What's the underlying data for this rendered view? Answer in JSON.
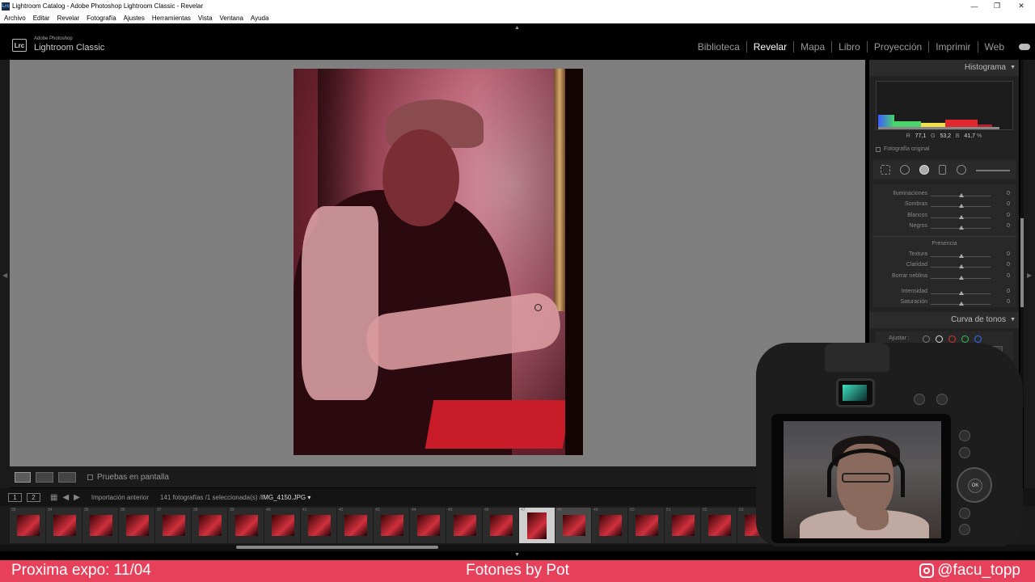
{
  "window": {
    "title": "Lightroom Catalog - Adobe Photoshop Lightroom Classic - Revelar",
    "app_icon": "Lrc",
    "controls": [
      "—",
      "❐",
      "✕"
    ]
  },
  "menu": [
    "Archivo",
    "Editar",
    "Revelar",
    "Fotografía",
    "Ajustes",
    "Herramientas",
    "Vista",
    "Ventana",
    "Ayuda"
  ],
  "brand": {
    "logo": "Lrc",
    "small": "Adobe Photoshop",
    "big": "Lightroom Classic"
  },
  "modules": [
    {
      "label": "Biblioteca",
      "active": false
    },
    {
      "label": "Revelar",
      "active": true
    },
    {
      "label": "Mapa",
      "active": false
    },
    {
      "label": "Libro",
      "active": false
    },
    {
      "label": "Proyección",
      "active": false
    },
    {
      "label": "Imprimir",
      "active": false
    },
    {
      "label": "Web",
      "active": false
    }
  ],
  "toolbar": {
    "proof_label": "Pruebas en pantalla"
  },
  "filmstrip_header": {
    "monitor1": "1",
    "monitor2": "2",
    "source": "Importación anterior",
    "count": "141 fotografías /1 seleccionada(s) /",
    "filename": "IMG_4150.JPG ▾"
  },
  "filmstrip": {
    "indexes": [
      "33",
      "34",
      "35",
      "36",
      "37",
      "38",
      "39",
      "40",
      "41",
      "42",
      "43",
      "44",
      "45",
      "46",
      "47",
      "48",
      "49",
      "50",
      "51",
      "52",
      "53"
    ],
    "selected_index": 14,
    "active_index": 15
  },
  "histogram": {
    "title": "Histograma",
    "r_label": "R",
    "r_value": "77,1",
    "g_label": "G",
    "g_value": "53,2",
    "b_label": "B",
    "b_value": "41,7",
    "unit": "%",
    "original_label": "Fotografía original"
  },
  "basic": {
    "rows": [
      {
        "label": "Iluminaciones",
        "value": "0"
      },
      {
        "label": "Sombras",
        "value": "0"
      },
      {
        "label": "Blancos",
        "value": "0"
      },
      {
        "label": "Negros",
        "value": "0"
      }
    ],
    "presence_title": "Presencia",
    "presence_rows": [
      {
        "label": "Textura",
        "value": "0"
      },
      {
        "label": "Claridad",
        "value": "0"
      },
      {
        "label": "Borrar neblina",
        "value": "0"
      },
      {
        "label": "Intensidad",
        "value": "0"
      },
      {
        "label": "Saturación",
        "value": "0"
      }
    ]
  },
  "tone_curve": {
    "title": "Curva de tonos",
    "adjust_label": "Ajustar :"
  },
  "camera": {
    "ok_label": "OK"
  },
  "banner": {
    "left": "Proxima expo: 11/04",
    "center": "Fotones by Pot",
    "right": "@facu_topp",
    "color": "#e6405a"
  }
}
